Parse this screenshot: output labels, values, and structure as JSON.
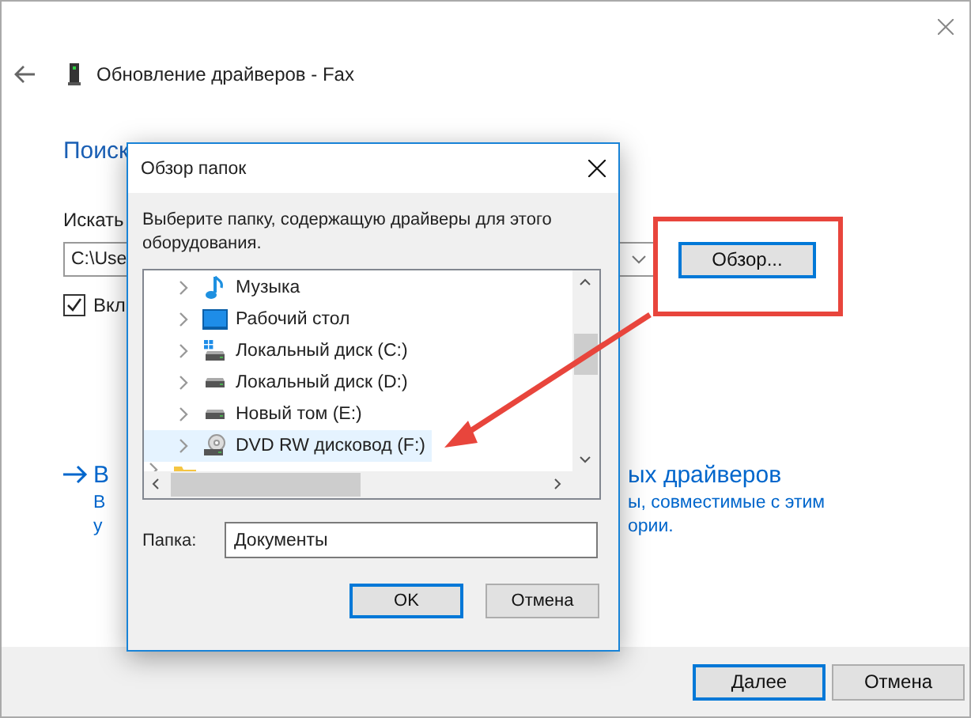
{
  "window": {
    "title": "Обновление драйверов - Fax",
    "heading": "Поиск",
    "search_label": "Искать",
    "path_field": {
      "value": "C:\\Use"
    },
    "browse_button": "Обзор...",
    "include_subfolders": {
      "label": "Вкл",
      "checked": true
    },
    "link_option": {
      "title_left": "В",
      "title_right": "ых драйверов",
      "desc_lines": [
        {
          "left": "В",
          "right": "ы, совместимые с этим"
        },
        {
          "left": "у",
          "right": "ории."
        }
      ]
    },
    "buttons": [
      {
        "label": "Далее",
        "default": true
      },
      {
        "label": "Отмена",
        "default": false
      }
    ]
  },
  "dialog": {
    "title": "Обзор папок",
    "instruction": "Выберите папку, содержащую драйверы для этого оборудования.",
    "tree": [
      {
        "kind": "music",
        "label": "Музыка",
        "selected": false
      },
      {
        "kind": "desktop",
        "label": "Рабочий стол",
        "selected": false
      },
      {
        "kind": "system-drive",
        "label": "Локальный диск (C:)",
        "selected": false
      },
      {
        "kind": "drive",
        "label": "Локальный диск (D:)",
        "selected": false
      },
      {
        "kind": "drive",
        "label": "Новый том (E:)",
        "selected": false
      },
      {
        "kind": "dvd",
        "label": "DVD RW дисковод (F:)",
        "selected": true
      },
      {
        "kind": "folder",
        "selected": false
      }
    ],
    "folder_label": "Папка:",
    "folder_field": {
      "value": "Документы"
    },
    "buttons": [
      {
        "label": "OK",
        "default": true
      },
      {
        "label": "Отмена",
        "default": false
      }
    ]
  },
  "annotation": {
    "highlight": true,
    "arrow": true
  }
}
